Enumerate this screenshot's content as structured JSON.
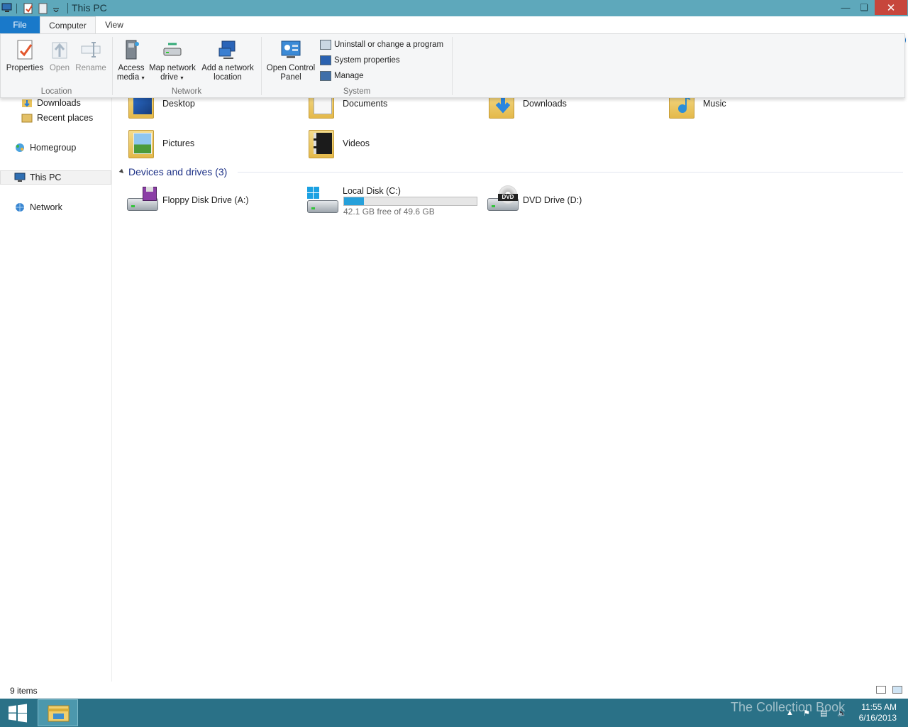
{
  "window": {
    "title": "This PC",
    "colors": {
      "titlebar": "#5ea8bb",
      "file_tab": "#1979ca",
      "close": "#c7463c",
      "taskbar": "#2a7187"
    }
  },
  "tabs": [
    {
      "label": "File"
    },
    {
      "label": "Computer"
    },
    {
      "label": "View"
    }
  ],
  "ribbon": {
    "groups": {
      "location": "Location",
      "network": "Network",
      "system": "System"
    },
    "location": {
      "properties": "Properties",
      "open": "Open",
      "rename": "Rename"
    },
    "network": {
      "access_media_l1": "Access",
      "access_media_l2": "media",
      "map_drive_l1": "Map network",
      "map_drive_l2": "drive",
      "add_location_l1": "Add a network",
      "add_location_l2": "location"
    },
    "system": {
      "control_panel_l1": "Open Control",
      "control_panel_l2": "Panel",
      "uninstall": "Uninstall or change a program",
      "system_properties": "System properties",
      "manage": "Manage"
    }
  },
  "nav": {
    "items": [
      {
        "label": "Downloads",
        "icon": "downloads-icon"
      },
      {
        "label": "Recent places",
        "icon": "recent-places-icon"
      },
      {
        "label": "Homegroup",
        "icon": "homegroup-icon"
      },
      {
        "label": "This PC",
        "icon": "computer-icon",
        "selected": true
      },
      {
        "label": "Network",
        "icon": "network-icon"
      }
    ]
  },
  "folders": [
    {
      "label": "Desktop",
      "icon": "desktop-folder-icon"
    },
    {
      "label": "Documents",
      "icon": "documents-folder-icon"
    },
    {
      "label": "Downloads",
      "icon": "downloads-folder-icon"
    },
    {
      "label": "Music",
      "icon": "music-folder-icon"
    },
    {
      "label": "Pictures",
      "icon": "pictures-folder-icon"
    },
    {
      "label": "Videos",
      "icon": "videos-folder-icon"
    }
  ],
  "devices": {
    "header": "Devices and drives (3)",
    "items": [
      {
        "label": "Floppy Disk Drive (A:)",
        "icon": "floppy-drive-icon"
      },
      {
        "label": "Local Disk (C:)",
        "icon": "local-disk-icon",
        "free_text": "42.1 GB free of 49.6 GB",
        "used_fraction": 0.151
      },
      {
        "label": "DVD Drive (D:)",
        "icon": "dvd-drive-icon",
        "badge": "DVD"
      }
    ]
  },
  "status": {
    "count": "9 items"
  },
  "taskbar": {
    "time": "11:55 AM",
    "date": "6/16/2013",
    "watermark": "The Collection Book"
  }
}
